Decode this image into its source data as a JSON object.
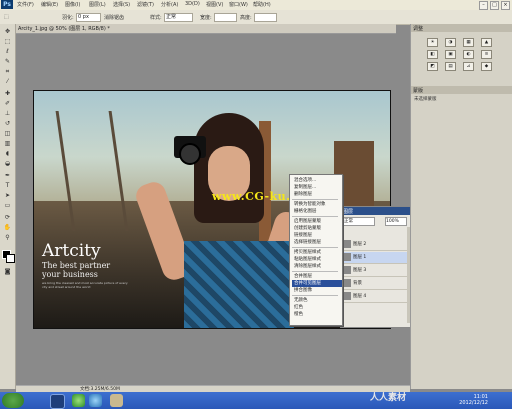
{
  "app": {
    "logo": "Ps"
  },
  "menubar": {
    "items": [
      "文件(F)",
      "编辑(E)",
      "图像(I)",
      "图层(L)",
      "选择(S)",
      "滤镜(T)",
      "分析(A)",
      "3D(D)",
      "视图(V)",
      "窗口(W)",
      "帮助(H)"
    ],
    "window_buttons": [
      "–",
      "□",
      "×"
    ]
  },
  "options_bar": {
    "feather_label": "羽化:",
    "feather_value": "0 px",
    "antialias_label": "消除锯齿",
    "style_label": "样式:",
    "style_value": "正常",
    "width_label": "宽度:",
    "height_label": "高度:"
  },
  "document": {
    "tab_title": "Arcity_1.jpg @ 50% (图层 1, RGB/8) *",
    "zoom": "50%"
  },
  "image": {
    "watermark": "www.CG-ku.com",
    "brand_title": "Artcity",
    "brand_tag1": "The best partner",
    "brand_tag2": "your business",
    "brand_small": "we bring the clearest and most accurate picture of every city and street around the world"
  },
  "context_menu": {
    "items": [
      "混合选项...",
      "复制图层...",
      "删除图层",
      "",
      "转换为智能对象",
      "栅格化图层",
      "",
      "启用图层蒙版",
      "创建剪贴蒙版",
      "链接图层",
      "选择链接图层",
      "",
      "拷贝图层样式",
      "粘贴图层样式",
      "清除图层样式",
      "",
      "合并图层",
      "合并可见图层",
      "拼合图像",
      "",
      "无颜色",
      "红色",
      "橙色"
    ],
    "selected_index": 17
  },
  "layers_panel": {
    "title": "图层",
    "blend_mode": "正常",
    "opacity": "100%",
    "layers": [
      {
        "name": "图层 2",
        "active": false
      },
      {
        "name": "图层 1",
        "active": true
      },
      {
        "name": "图层 3",
        "active": false
      },
      {
        "name": "背景",
        "active": false
      },
      {
        "name": "图层 4",
        "active": false
      }
    ]
  },
  "right_panel": {
    "adjustments_title": "调整",
    "adjust_icons": [
      "☀",
      "◑",
      "▦",
      "▲",
      "◧",
      "▣",
      "◐",
      "≋",
      "◩",
      "▤",
      "⊿",
      "◆"
    ],
    "masks_title": "蒙版",
    "masks_text": "未选择蒙版"
  },
  "status_bar": {
    "text": "文档:3.25M/6.50M"
  },
  "taskbar": {
    "time": "11:01",
    "date": "2012/12/12"
  },
  "site_logo": "人人素材",
  "colors": {
    "accent": "#2a4f9a",
    "watermark": "#f5e61a",
    "taskbar": "#2a58b8"
  }
}
